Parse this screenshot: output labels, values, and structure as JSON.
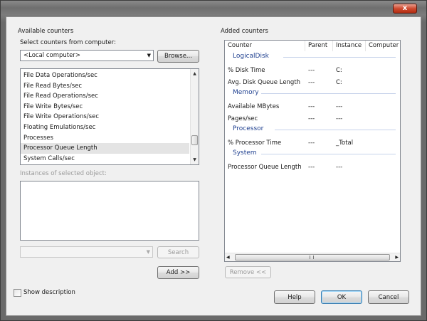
{
  "window": {
    "close_label": "x"
  },
  "available": {
    "group_title": "Available counters",
    "select_label": "Select counters from computer:",
    "computer_value": "<Local computer>",
    "browse_label": "Browse...",
    "counters": [
      "File Data Operations/sec",
      "File Read Bytes/sec",
      "File Read Operations/sec",
      "File Write Bytes/sec",
      "File Write Operations/sec",
      "Floating Emulations/sec",
      "Processes",
      "Processor Queue Length",
      "System Calls/sec"
    ],
    "selected_counter": "Processor Queue Length",
    "instances_label": "Instances of selected object:",
    "search_label": "Search",
    "add_label": "Add >>"
  },
  "added": {
    "group_title": "Added counters",
    "columns": [
      "Counter",
      "Parent",
      "Instance",
      "Computer"
    ],
    "sections": [
      {
        "name": "LogicalDisk",
        "rows": [
          {
            "counter": "% Disk Time",
            "parent": "---",
            "instance": "C:"
          },
          {
            "counter": "Avg. Disk Queue Length",
            "parent": "---",
            "instance": "C:"
          }
        ]
      },
      {
        "name": "Memory",
        "rows": [
          {
            "counter": "Available MBytes",
            "parent": "---",
            "instance": "---"
          },
          {
            "counter": "Pages/sec",
            "parent": "---",
            "instance": "---"
          }
        ]
      },
      {
        "name": "Processor",
        "rows": [
          {
            "counter": "% Processor Time",
            "parent": "---",
            "instance": "_Total"
          }
        ]
      },
      {
        "name": "System",
        "rows": [
          {
            "counter": "Processor Queue Length",
            "parent": "---",
            "instance": "---"
          }
        ]
      }
    ],
    "remove_label": "Remove <<"
  },
  "footer": {
    "show_description": "Show description",
    "help_label": "Help",
    "ok_label": "OK",
    "cancel_label": "Cancel"
  }
}
